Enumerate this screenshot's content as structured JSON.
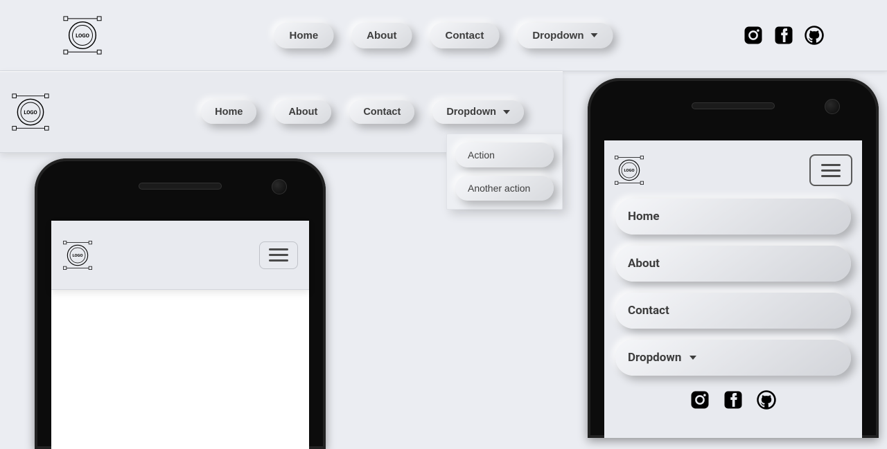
{
  "logo_text": "LOGO",
  "nav": {
    "items": [
      {
        "label": "Home"
      },
      {
        "label": "About"
      },
      {
        "label": "Contact"
      },
      {
        "label": "Dropdown"
      }
    ],
    "dropdown_items": [
      {
        "label": "Action"
      },
      {
        "label": "Another action"
      }
    ]
  },
  "socials": [
    {
      "name": "instagram"
    },
    {
      "name": "facebook"
    },
    {
      "name": "github"
    }
  ],
  "colors": {
    "background": "#ebedf2",
    "text": "#3d3d3d",
    "shadow_dark": "rgba(0,0,0,.25)",
    "shadow_light": "rgba(255,255,255,.9)"
  }
}
